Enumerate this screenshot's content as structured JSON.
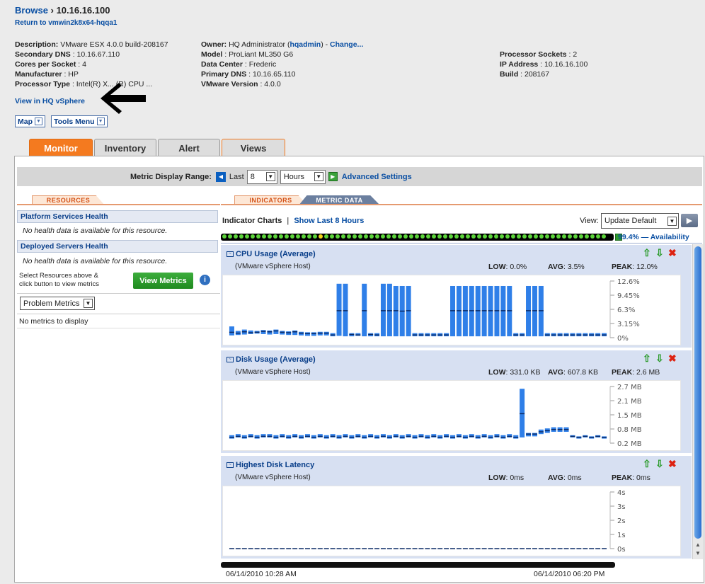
{
  "header": {
    "breadcrumb_link": "Browse",
    "breadcrumb_sep": "›",
    "title": "10.16.16.100",
    "return_link": "Return to vmwin2k8x64-hqqa1"
  },
  "props": {
    "col1": [
      {
        "k": "Description:",
        "v": "VMware ESX 4.0.0 build-208167"
      },
      {
        "k": "Secondary DNS",
        "v": ": 10.16.67.110"
      },
      {
        "k": "Cores per Socket",
        "v": ": 4"
      },
      {
        "k": "Manufacturer",
        "v": ": HP"
      },
      {
        "k": "Processor Type",
        "v": ": Intel(R) X... (R) CPU ..."
      }
    ],
    "owner_label": "Owner:",
    "owner_value": "HQ Administrator (",
    "owner_user": "hqadmin",
    "owner_after": ") - ",
    "owner_change": "Change...",
    "col2": [
      {
        "k": "Model",
        "v": ": ProLiant ML350 G6"
      },
      {
        "k": "Data Center",
        "v": ": Frederic"
      },
      {
        "k": "Primary DNS",
        "v": ": 10.16.65.110"
      },
      {
        "k": "VMware Version",
        "v": ": 4.0.0"
      }
    ],
    "col3": [
      {
        "k": "Processor Sockets",
        "v": ": 2"
      },
      {
        "k": "IP Address",
        "v": ": 10.16.16.100"
      },
      {
        "k": "Build",
        "v": ": 208167"
      }
    ]
  },
  "view_in_vsphere": "View in HQ vSphere",
  "menus": {
    "map": "Map",
    "tools": "Tools Menu"
  },
  "tabs": [
    "Monitor",
    "Inventory",
    "Alert",
    "Views"
  ],
  "range": {
    "label": "Metric Display Range:",
    "last": "Last",
    "count": "8",
    "unit": "Hours",
    "advanced": "Advanced Settings"
  },
  "left": {
    "tab": "RESOURCES",
    "platform_head": "Platform Services Health",
    "platform_msg": "No health data is available for this resource.",
    "deployed_head": "Deployed Servers Health",
    "deployed_msg": "No health data is available for this resource.",
    "select_hint_1": "Select Resources above &",
    "select_hint_2": "click button to view metrics",
    "view_metrics": "View Metrics",
    "problem_metrics": "Problem Metrics",
    "no_metrics": "No metrics to display"
  },
  "right": {
    "tab_indicators": "INDICATORS",
    "tab_metric": "METRIC DATA",
    "indicator_charts": "Indicator Charts",
    "sep": "|",
    "show_last": "Show Last 8 Hours",
    "view_label": "View:",
    "view_value": "Update Default",
    "availability": "99.4% — Availability"
  },
  "charts": [
    {
      "title": "CPU Usage (Average)",
      "sub": "(VMware vSphere Host)",
      "low_label": "LOW",
      "low": ": 0.0%",
      "avg_label": "AVG",
      "avg": ": 3.5%",
      "peak_label": "PEAK",
      "peak": ": 12.0%",
      "ticks": [
        "12.6%",
        "9.45%",
        "6.3%",
        "3.15%",
        "0%"
      ],
      "ymax": 12.6
    },
    {
      "title": "Disk Usage (Average)",
      "sub": "(VMware vSphere Host)",
      "low_label": "LOW",
      "low": ": 331.0 KB",
      "avg_label": "AVG",
      "avg": ": 607.8 KB",
      "peak_label": "PEAK",
      "peak": ": 2.6 MB",
      "ticks": [
        "2.7 MB",
        "2.1 MB",
        "1.5 MB",
        "0.8 MB",
        "0.2 MB"
      ],
      "ymax": 2.7
    },
    {
      "title": "Highest Disk Latency",
      "sub": "(VMware vSphere Host)",
      "low_label": "LOW",
      "low": ": 0ms",
      "avg_label": "AVG",
      "avg": ": 0ms",
      "peak_label": "PEAK",
      "peak": ": 0ms",
      "ticks": [
        "4s",
        "3s",
        "2s",
        "1s",
        "0s"
      ],
      "ymax": 4
    }
  ],
  "time": {
    "start": "06/14/2010 10:28 AM",
    "end": "06/14/2010 06:20 PM"
  },
  "chart_data": [
    {
      "type": "bar",
      "title": "CPU Usage (Average)",
      "ylim": [
        0,
        12.6
      ],
      "series": [
        {
          "name": "CPU Usage (Average)",
          "low": [
            0.5,
            0.6,
            0.7,
            0.8,
            0.9,
            0.8,
            0.7,
            0.8,
            0.7,
            0.6,
            0.6,
            0.5,
            0.4,
            0.4,
            0.5,
            0.5,
            0.3,
            0.4,
            0.3,
            0.3,
            0.4,
            0.3,
            0.3,
            0.3,
            0.3,
            0.3,
            0.3,
            0.3,
            0.3,
            0.3,
            0.3,
            0.3,
            0.3,
            0.3,
            0.3,
            0.3,
            0.3,
            0.3,
            0.3,
            0.3,
            0.3,
            0.3,
            0.3,
            0.3,
            0.3,
            0.3,
            0.3,
            0.3,
            0.3,
            0.3,
            0.3,
            0.3,
            0.3,
            0.3,
            0.3,
            0.3,
            0.3,
            0.3,
            0.3,
            0.3
          ],
          "avg": [
            1.2,
            1.0,
            1.3,
            1.1,
            1.2,
            1.4,
            1.3,
            1.5,
            1.2,
            1.1,
            1.3,
            1.0,
            0.9,
            0.9,
            1.0,
            1.0,
            0.6,
            6.0,
            6.0,
            0.7,
            0.6,
            6.0,
            0.7,
            0.6,
            6.0,
            6.0,
            6.0,
            5.9,
            6.0,
            0.6,
            0.6,
            0.6,
            0.6,
            0.6,
            0.6,
            6.0,
            6.0,
            6.0,
            6.0,
            6.0,
            6.0,
            6.0,
            6.0,
            6.0,
            6.0,
            0.6,
            0.6,
            6.0,
            6.0,
            6.0,
            0.6,
            0.6,
            0.6,
            0.6,
            0.6,
            0.6,
            0.6,
            0.6,
            0.6,
            0.6
          ],
          "high": [
            2.5,
            1.5,
            1.8,
            1.6,
            1.5,
            1.7,
            1.6,
            1.8,
            1.5,
            1.4,
            1.6,
            1.3,
            1.2,
            1.2,
            1.3,
            1.3,
            1.0,
            12.0,
            12.0,
            1.0,
            1.0,
            12.0,
            1.0,
            1.0,
            12.0,
            12.0,
            11.5,
            11.5,
            11.5,
            1.0,
            1.0,
            1.0,
            1.0,
            1.0,
            1.0,
            11.5,
            11.5,
            11.5,
            11.5,
            11.5,
            11.5,
            11.5,
            11.5,
            11.5,
            11.5,
            1.0,
            1.0,
            11.5,
            11.5,
            11.5,
            1.0,
            1.0,
            1.0,
            1.0,
            1.0,
            1.0,
            1.0,
            1.0,
            1.0,
            1.0
          ]
        }
      ]
    },
    {
      "type": "bar",
      "title": "Disk Usage (Average)",
      "ylim": [
        0.2,
        2.7
      ],
      "series": [
        {
          "name": "Disk Usage (Average)",
          "low": [
            0.4,
            0.45,
            0.4,
            0.45,
            0.4,
            0.45,
            0.45,
            0.4,
            0.45,
            0.4,
            0.45,
            0.4,
            0.45,
            0.4,
            0.45,
            0.4,
            0.45,
            0.4,
            0.45,
            0.4,
            0.45,
            0.4,
            0.45,
            0.4,
            0.45,
            0.4,
            0.45,
            0.4,
            0.45,
            0.4,
            0.45,
            0.4,
            0.45,
            0.4,
            0.45,
            0.4,
            0.45,
            0.4,
            0.45,
            0.4,
            0.45,
            0.4,
            0.45,
            0.4,
            0.45,
            0.4,
            0.45,
            0.5,
            0.5,
            0.6,
            0.65,
            0.7,
            0.7,
            0.7,
            0.45,
            0.4,
            0.45,
            0.4,
            0.45,
            0.4
          ],
          "avg": [
            0.45,
            0.5,
            0.45,
            0.5,
            0.45,
            0.5,
            0.5,
            0.45,
            0.5,
            0.45,
            0.5,
            0.45,
            0.5,
            0.45,
            0.5,
            0.45,
            0.5,
            0.45,
            0.5,
            0.45,
            0.5,
            0.45,
            0.5,
            0.45,
            0.5,
            0.45,
            0.5,
            0.45,
            0.5,
            0.45,
            0.5,
            0.45,
            0.5,
            0.45,
            0.5,
            0.45,
            0.5,
            0.45,
            0.5,
            0.45,
            0.5,
            0.45,
            0.5,
            0.45,
            0.5,
            0.45,
            1.5,
            0.6,
            0.6,
            0.7,
            0.75,
            0.8,
            0.8,
            0.8,
            0.5,
            0.45,
            0.5,
            0.45,
            0.5,
            0.45
          ],
          "high": [
            0.55,
            0.6,
            0.55,
            0.6,
            0.55,
            0.6,
            0.6,
            0.55,
            0.6,
            0.55,
            0.6,
            0.55,
            0.6,
            0.55,
            0.6,
            0.55,
            0.6,
            0.55,
            0.6,
            0.55,
            0.6,
            0.55,
            0.6,
            0.55,
            0.6,
            0.55,
            0.6,
            0.55,
            0.6,
            0.55,
            0.6,
            0.55,
            0.6,
            0.55,
            0.6,
            0.55,
            0.6,
            0.55,
            0.6,
            0.55,
            0.6,
            0.55,
            0.6,
            0.55,
            0.6,
            0.55,
            2.6,
            0.65,
            0.65,
            0.8,
            0.85,
            0.9,
            0.9,
            0.9,
            0.55,
            0.5,
            0.55,
            0.5,
            0.55,
            0.5
          ]
        }
      ]
    },
    {
      "type": "line",
      "title": "Highest Disk Latency",
      "ylim": [
        0,
        4
      ],
      "series": [
        {
          "name": "Highest Disk Latency",
          "values": [
            0,
            0,
            0,
            0,
            0,
            0,
            0,
            0,
            0,
            0,
            0,
            0,
            0,
            0,
            0,
            0,
            0,
            0,
            0,
            0,
            0,
            0,
            0,
            0,
            0,
            0,
            0,
            0,
            0,
            0,
            0,
            0,
            0,
            0,
            0,
            0,
            0,
            0,
            0,
            0,
            0,
            0,
            0,
            0,
            0,
            0,
            0,
            0,
            0,
            0,
            0,
            0,
            0,
            0,
            0,
            0,
            0,
            0,
            0,
            0
          ]
        }
      ]
    }
  ]
}
